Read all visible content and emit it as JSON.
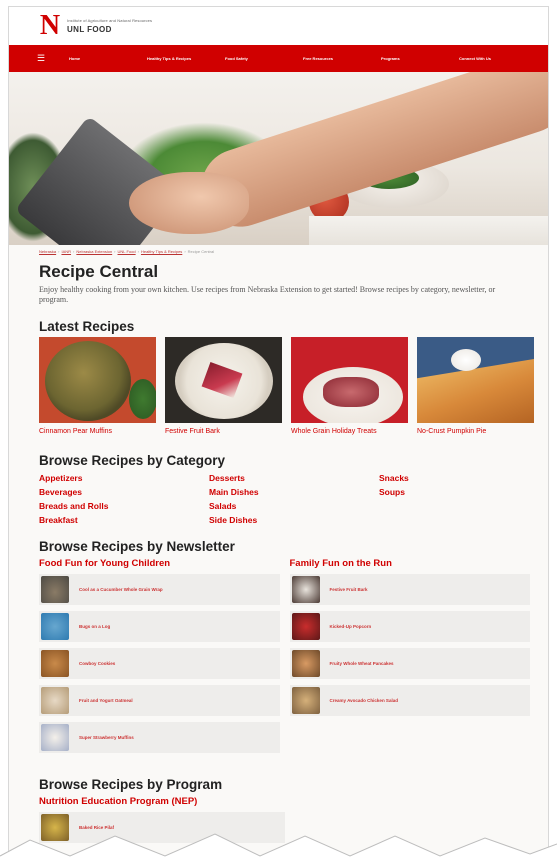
{
  "header": {
    "subtitle": "Institute of Agriculture and Natural Resources",
    "site_name": "UNL FOOD",
    "logo_letter": "N"
  },
  "nav": {
    "items": [
      "Home",
      "Healthy Tips & Recipes",
      "Food Safety",
      "Free Resources",
      "Programs",
      "Connect With Us"
    ]
  },
  "breadcrumb": [
    "Nebraska",
    "IANR",
    "Nebraska Extension",
    "UNL Food",
    "Healthy Tips & Recipes",
    "Recipe Central"
  ],
  "page": {
    "title": "Recipe Central",
    "intro": "Enjoy healthy cooking from your own kitchen. Use recipes from Nebraska Extension to get started! Browse recipes by category, newsletter, or program."
  },
  "latest": {
    "heading": "Latest Recipes",
    "cards": [
      {
        "label": "Cinnamon Pear Muffins"
      },
      {
        "label": "Festive Fruit Bark"
      },
      {
        "label": "Whole Grain Holiday Treats"
      },
      {
        "label": "No-Crust Pumpkin Pie"
      }
    ]
  },
  "categories": {
    "heading": "Browse Recipes by Category",
    "col1": [
      "Appetizers",
      "Beverages",
      "Breads and Rolls",
      "Breakfast"
    ],
    "col2": [
      "Desserts",
      "Main Dishes",
      "Salads",
      "Side Dishes"
    ],
    "col3": [
      "Snacks",
      "Soups"
    ]
  },
  "newsletter": {
    "heading": "Browse Recipes by Newsletter",
    "left": {
      "title": "Food Fun for Young Children",
      "items": [
        "Cool as a Cucumber Whole Grain Wrap",
        "Bugs on a Log",
        "Cowboy Cookies",
        "Fruit and Yogurt Oatmeal",
        "Super Strawberry Muffins"
      ]
    },
    "right": {
      "title": "Family Fun on the Run",
      "items": [
        "Festive Fruit Bark",
        "Kicked-Up Popcorn",
        "Fruity Whole Wheat Pancakes",
        "Creamy Avocado Chicken Salad"
      ]
    }
  },
  "program": {
    "heading": "Browse Recipes by Program",
    "title": "Nutrition Education Program (NEP)",
    "items": [
      "Baked Rice Pilaf"
    ]
  }
}
